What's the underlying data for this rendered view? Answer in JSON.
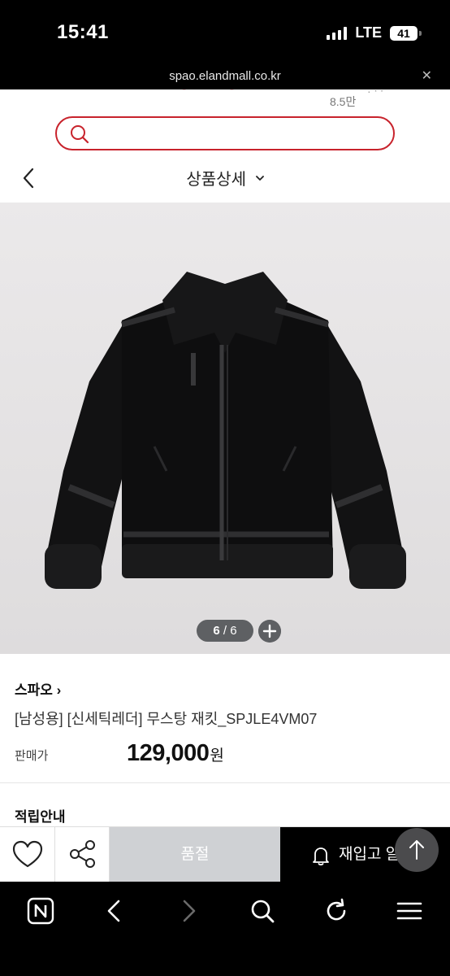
{
  "status": {
    "time": "15:41",
    "network": "LTE",
    "battery": "41"
  },
  "browser": {
    "url": "spao.elandmall.co.kr",
    "close_icon": "close-icon"
  },
  "header": {
    "follower_count": "8.5만",
    "search": {
      "placeholder": ""
    }
  },
  "subheader": {
    "title": "상품상세"
  },
  "gallery": {
    "current": "6",
    "separator": " / ",
    "total": "6",
    "image": "black suede shearling mustang jacket"
  },
  "product": {
    "brand": "스파오 ›",
    "name": "[남성용] [신세틱레더] 무스탕 재킷_SPJLE4VM07",
    "price_label": "판매가",
    "price": "129,000",
    "price_unit": "원",
    "points_title": "적립안내"
  },
  "actions": {
    "soldout": "품절",
    "restock": "재입고 알림"
  },
  "colors": {
    "accent": "#c8232c",
    "soldout_bg": "#cfd1d4",
    "restock_bg": "#000000",
    "scroll_top_bg": "#4b4b4d"
  }
}
